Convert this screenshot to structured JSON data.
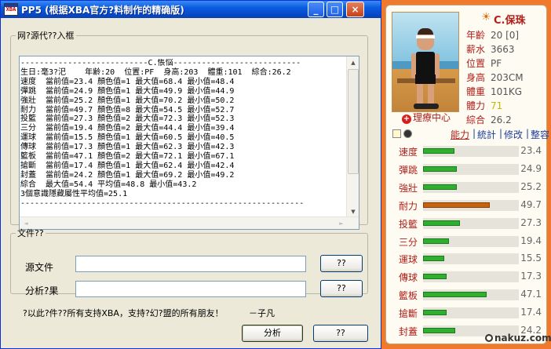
{
  "window": {
    "title": "PP5 (根据XBA官方?料制作的精确版)",
    "icon_text": "XBA",
    "controls": {
      "minimize": "_",
      "maximize": "□",
      "close": "×"
    },
    "colors": {
      "titlebar": "#0a5be0",
      "close": "#c7401a"
    }
  },
  "output_group": {
    "legend": "网?源代??入框",
    "lines": [
      "---------------------------C.悵悩---------------------------",
      "生日:毫3?汜    年齢:20  位置:PF  身高:203  體重:101  綜合:26.2",
      "速度  當前值=23.4 顏色值=1 最大值=68.4 最小值=48.4",
      "彈跳  當前值=24.9 顏色值=1 最大值=49.9 最小值=44.9",
      "強壯  當前值=25.2 顏色值=1 最大值=70.2 最小值=50.2",
      "耐力  當前值=49.7 顏色值=8 最大值=54.5 最小值=52.7",
      "投籃  當前值=27.3 顏色值=2 最大值=72.3 最小值=52.3",
      "三分  當前值=19.4 顏色值=2 最大值=44.4 最小值=39.4",
      "運球  當前值=15.5 顏色值=1 最大值=60.5 最小值=40.5",
      "傳球  當前值=17.3 顏色值=1 最大值=62.3 最小值=42.3",
      "籃板  當前值=47.1 顏色值=2 最大值=72.1 最小值=67.1",
      "搶斷  當前值=17.4 顏色值=1 最大值=62.4 最小值=42.4",
      "封蓋  當前值=24.2 顏色值=1 最大值=69.2 最小值=49.2",
      "綜合  最大值=54.4 平均值=48.8 最小值=43.2",
      "3個意識隱藏屬性平均值=25.1",
      "------------------------------------------------------------"
    ],
    "scroll": {
      "up": "▲",
      "down": "▼",
      "left": "◄",
      "right": "►"
    }
  },
  "file_group": {
    "legend": "文件??",
    "source_label": "源文件",
    "source_value": "",
    "source_button": "??",
    "result_label": "分析?果",
    "result_value": "",
    "result_button": "??"
  },
  "footer": {
    "note": "?以此?件??所有支持XBA，支持?幻?盟的所有朋友！",
    "author": "－子凡",
    "analyze_button": "分析",
    "help_button": "??"
  },
  "player": {
    "name": "C.保珠",
    "rehab": "理療中心",
    "rehab_icon": "+",
    "sun_icon": "☀",
    "info": [
      {
        "label": "年齡",
        "value": "20 [0]",
        "color": "#555555"
      },
      {
        "label": "薪水",
        "value": "3663",
        "color": "#555555"
      },
      {
        "label": "位置",
        "value": "PF",
        "color": "#555555"
      },
      {
        "label": "身高",
        "value": "203CM",
        "color": "#555555"
      },
      {
        "label": "體重",
        "value": "101KG",
        "color": "#555555"
      },
      {
        "label": "體力",
        "value": "71",
        "color": "#c8b400"
      },
      {
        "label": "綜合",
        "value": "26.2",
        "color": "#555555"
      }
    ],
    "tabs": [
      {
        "label": "能力",
        "active": true
      },
      {
        "label": "統計",
        "active": false
      },
      {
        "label": "修改",
        "active": false
      },
      {
        "label": "整容",
        "active": false
      }
    ],
    "stat_max": 70,
    "stats": [
      {
        "label": "速度",
        "value": 23.4,
        "highlight": false
      },
      {
        "label": "彈跳",
        "value": 24.9,
        "highlight": false
      },
      {
        "label": "強壯",
        "value": 25.2,
        "highlight": false
      },
      {
        "label": "耐力",
        "value": 49.7,
        "highlight": true
      },
      {
        "label": "投籃",
        "value": 27.3,
        "highlight": false
      },
      {
        "label": "三分",
        "value": 19.4,
        "highlight": false
      },
      {
        "label": "運球",
        "value": 15.5,
        "highlight": false
      },
      {
        "label": "傳球",
        "value": 17.3,
        "highlight": false
      },
      {
        "label": "籃板",
        "value": 47.1,
        "highlight": false
      },
      {
        "label": "搶斷",
        "value": 17.4,
        "highlight": false
      },
      {
        "label": "封蓋",
        "value": 24.2,
        "highlight": false
      }
    ],
    "colors": {
      "accent": "#b0201a",
      "panel_border": "#f07a2c",
      "bar": "#2fae2f",
      "bar_highlight": "#c5640e"
    }
  },
  "watermark": "nakuz.com"
}
